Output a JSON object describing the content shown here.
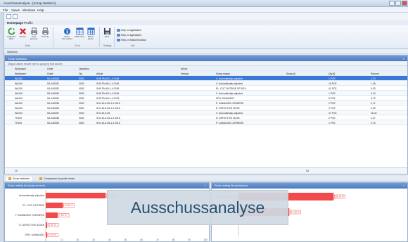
{
  "window": {
    "title": "Ausschussanalyse - [Scrap statistics]"
  },
  "menu": {
    "file": "File",
    "views": "Views",
    "windows": "Windows",
    "help": "Help"
  },
  "side_tab": "Navigation",
  "ribbon": {
    "tabs": [
      "Homepage",
      "Profile"
    ],
    "buttons": [
      {
        "label": "Augment table",
        "icon": "refresh-icon"
      },
      {
        "label": "Cancel",
        "icon": "cancel-icon"
      },
      {
        "label": "Print preview",
        "icon": "print-preview-icon"
      },
      {
        "label": "Print all",
        "icon": "print-icon"
      },
      {
        "label": "Order information",
        "icon": "info-icon"
      },
      {
        "label": "Table view",
        "icon": "table-view-icon"
      },
      {
        "label": "Matrix layout",
        "icon": "matrix-icon"
      },
      {
        "label": "Save",
        "icon": "save-icon"
      }
    ],
    "links": [
      "Help on application",
      "Help on application",
      "Help on feature/function"
    ],
    "groups": [
      "Data",
      "Go to",
      "Settings",
      "Info"
    ]
  },
  "selection_label": "Selection",
  "grid": {
    "title": "Scrap statistics",
    "group_hint": "Drag a column header here to group by that column",
    "bands": [
      "Workplace",
      "Order",
      "Operation",
      "Article"
    ],
    "columns": [
      "Workplace",
      "Order",
      "Op.",
      "Article",
      "Version",
      "Scrap reason",
      "Scrap [t]",
      "Qty [t]",
      "Percent"
    ],
    "rows": [
      [
        "WA100",
        "SA-160080",
        "0030",
        "SHS FM-60-1-4 0015",
        "",
        "V: Automatically adjusted",
        "",
        "1 PCE",
        "1,23"
      ],
      [
        "WA100",
        "SA-160081",
        "0030",
        "SHS FM-60-1-4 0015",
        "",
        "V: Automatically adjusted",
        "",
        "18 PCE",
        "1,08"
      ],
      [
        "WA100",
        "SA-160082",
        "0030",
        "SHS FM-60-1-4 0015",
        "",
        "EL: CUT OUTSIDE OF BOX",
        "",
        "41 PCE",
        "0,53"
      ],
      [
        "WA100",
        "SA-160083",
        "0030",
        "SHS FM-60-1-4 0015",
        "",
        "V: Automatically adjusted",
        "",
        "1 PCE",
        "0,13"
      ],
      [
        "WA100",
        "SA-160084",
        "0030",
        "SHS FM-60-1-4 0015",
        "",
        "SPH: DAMAGED",
        "",
        "6 PCE",
        "0,79"
      ],
      [
        "WA100",
        "SA-160085",
        "0030",
        "SHL 40-6-05-1-4 0015",
        "",
        "P: DAMAGED CORNERS",
        "",
        "2 PCE",
        "0,71"
      ],
      [
        "WA100",
        "SA-160086",
        "0030",
        "SHL 40-6-05-1-4 0015",
        "",
        "E: DEFECTIVE EDGE",
        "",
        "2 PCE",
        "0,45"
      ],
      [
        "WA100",
        "SA-160087",
        "0030",
        "SHL 40-6-05",
        "",
        "V: Automatically adjusted",
        "",
        "47 PCE",
        "26,40"
      ],
      [
        "TR100",
        "SA-160088",
        "0030",
        "SHL 40-6-05-1-4 0015",
        "",
        "E: DEFECTIVE EDGE",
        "",
        "2 PCE",
        "0,37"
      ],
      [
        "TR100",
        "SA-160089",
        "0030",
        "SHL 40-6-05-1-4 0015",
        "",
        "P: DAMAGED CORNERS",
        "",
        "1 PCE",
        "0,75"
      ]
    ],
    "footer_count": "10",
    "footer_total": "94"
  },
  "bottom_tabs": [
    "Scrap statistics",
    "Comparison by profit centre"
  ],
  "charts": {
    "left_title": "Scrap ranking list (scrap amount)",
    "right_title": "Scrap ranking list (workplace)"
  },
  "chart_data": [
    {
      "type": "bar",
      "orientation": "horizontal",
      "title": "Scrap ranking list (scrap amount)",
      "categories": [
        "Automatically adjusted",
        "EL: CUT OUTSIDE",
        "P: DAMAGED CORNERS",
        "E: DEFECTIVE EDGE",
        "SPH: DAMAGED"
      ],
      "values": [
        37.53,
        10.8,
        7.5,
        0.91,
        0.79
      ],
      "data_labels": [
        "37.53 %",
        "10.80 %",
        "7.50 %",
        "0.91 %",
        "0.79 %"
      ],
      "xlim": [
        0,
        100
      ],
      "xticks": [
        "0",
        "10",
        "20",
        "30",
        "40",
        "50",
        "60",
        "70",
        "80",
        "90",
        "100"
      ],
      "bar_color": "#f2494c"
    },
    {
      "type": "bar",
      "orientation": "horizontal",
      "title": "Scrap ranking list (workplace)",
      "categories": [
        "WA100 Lamination",
        "TR100 Pressing"
      ],
      "values": [
        58.33,
        31.18
      ],
      "data_labels": [
        "58.33 %",
        "31.18 %"
      ],
      "xlim": [
        0,
        100
      ],
      "bar_color": "#f2494c"
    }
  ],
  "overlay_caption": "Ausschussanalyse",
  "colors": {
    "accent": "#4c7bc0",
    "selected_row": "#3a78d8",
    "bar": "#f2494c"
  }
}
